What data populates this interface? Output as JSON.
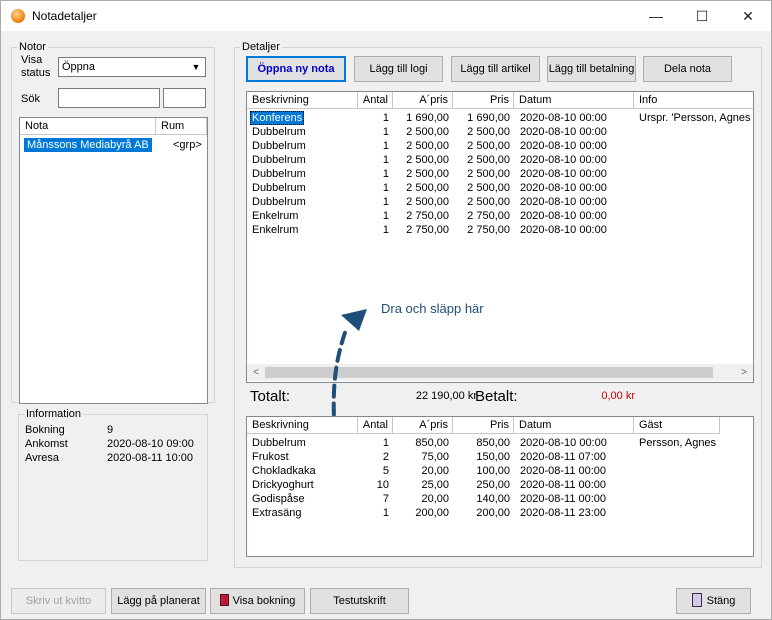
{
  "window": {
    "title": "Notadetaljer",
    "minimize": "—",
    "maximize": "☐",
    "close": "✕"
  },
  "notor": {
    "group_label": "Notor",
    "visa_status_label_line1": "Visa",
    "visa_status_label_line2": "status",
    "status_selected": "Öppna",
    "sok_label": "Sök",
    "list_headers": [
      "Nota",
      "Rum"
    ],
    "items": [
      {
        "nota": "Månssons Mediabyrå AB",
        "rum": "<grp>"
      }
    ]
  },
  "information": {
    "group_label": "Information",
    "rows": [
      {
        "label": "Bokning",
        "value": "9"
      },
      {
        "label": "Ankomst",
        "value": "2020-08-10 09:00"
      },
      {
        "label": "Avresa",
        "value": "2020-08-11 10:00"
      }
    ]
  },
  "detaljer": {
    "group_label": "Detaljer",
    "buttons": {
      "open_new": "Öppna ny nota",
      "add_lodging": "Lägg till logi",
      "add_article": "Lägg till artikel",
      "add_payment": "Lägg till betalning",
      "share": "Dela nota"
    },
    "top_headers": [
      "Beskrivning",
      "Antal",
      "A´pris",
      "Pris",
      "Datum",
      "Info"
    ],
    "top_rows": [
      {
        "desc": "Konferens",
        "antal": "1",
        "apris": "1 690,00",
        "pris": "1 690,00",
        "datum": "2020-08-10 00:00",
        "info": "Urspr. 'Persson, Agnes ("
      },
      {
        "desc": "Dubbelrum",
        "antal": "1",
        "apris": "2 500,00",
        "pris": "2 500,00",
        "datum": "2020-08-10 00:00",
        "info": ""
      },
      {
        "desc": "Dubbelrum",
        "antal": "1",
        "apris": "2 500,00",
        "pris": "2 500,00",
        "datum": "2020-08-10 00:00",
        "info": ""
      },
      {
        "desc": "Dubbelrum",
        "antal": "1",
        "apris": "2 500,00",
        "pris": "2 500,00",
        "datum": "2020-08-10 00:00",
        "info": ""
      },
      {
        "desc": "Dubbelrum",
        "antal": "1",
        "apris": "2 500,00",
        "pris": "2 500,00",
        "datum": "2020-08-10 00:00",
        "info": ""
      },
      {
        "desc": "Dubbelrum",
        "antal": "1",
        "apris": "2 500,00",
        "pris": "2 500,00",
        "datum": "2020-08-10 00:00",
        "info": ""
      },
      {
        "desc": "Dubbelrum",
        "antal": "1",
        "apris": "2 500,00",
        "pris": "2 500,00",
        "datum": "2020-08-10 00:00",
        "info": ""
      },
      {
        "desc": "Enkelrum",
        "antal": "1",
        "apris": "2 750,00",
        "pris": "2 750,00",
        "datum": "2020-08-10 00:00",
        "info": ""
      },
      {
        "desc": "Enkelrum",
        "antal": "1",
        "apris": "2 750,00",
        "pris": "2 750,00",
        "datum": "2020-08-10 00:00",
        "info": ""
      }
    ],
    "drag_hint": "Dra och släpp här",
    "totalt_label": "Totalt:",
    "totalt_value": "22 190,00 kr",
    "betalt_label": "Betalt:",
    "betalt_value": "0,00 kr",
    "betalt_color": "#cc0000",
    "bottom_headers": [
      "Beskrivning",
      "Antal",
      "A´pris",
      "Pris",
      "Datum",
      "Gäst"
    ],
    "bottom_rows": [
      {
        "desc": "Dubbelrum",
        "antal": "1",
        "apris": "850,00",
        "pris": "850,00",
        "datum": "2020-08-10 00:00",
        "gast": "Persson, Agnes"
      },
      {
        "desc": "Frukost",
        "antal": "2",
        "apris": "75,00",
        "pris": "150,00",
        "datum": "2020-08-11 07:00",
        "gast": ""
      },
      {
        "desc": "Chokladkaka",
        "antal": "5",
        "apris": "20,00",
        "pris": "100,00",
        "datum": "2020-08-11 00:00",
        "gast": ""
      },
      {
        "desc": "Drickyoghurt",
        "antal": "10",
        "apris": "25,00",
        "pris": "250,00",
        "datum": "2020-08-11 00:00",
        "gast": ""
      },
      {
        "desc": "Godispåse",
        "antal": "7",
        "apris": "20,00",
        "pris": "140,00",
        "datum": "2020-08-11 00:00",
        "gast": ""
      },
      {
        "desc": "Extrasäng",
        "antal": "1",
        "apris": "200,00",
        "pris": "200,00",
        "datum": "2020-08-11 23:00",
        "gast": ""
      }
    ]
  },
  "footer": {
    "print_receipt": "Skriv ut kvitto",
    "add_scheduled": "Lägg på planerat",
    "show_booking": "Visa bokning",
    "test_print": "Testutskrift",
    "close": "Stäng"
  },
  "colors": {
    "accent": "#0078d7",
    "drag_arrow": "#1f4e79",
    "default_button_text": "#0000cc"
  }
}
